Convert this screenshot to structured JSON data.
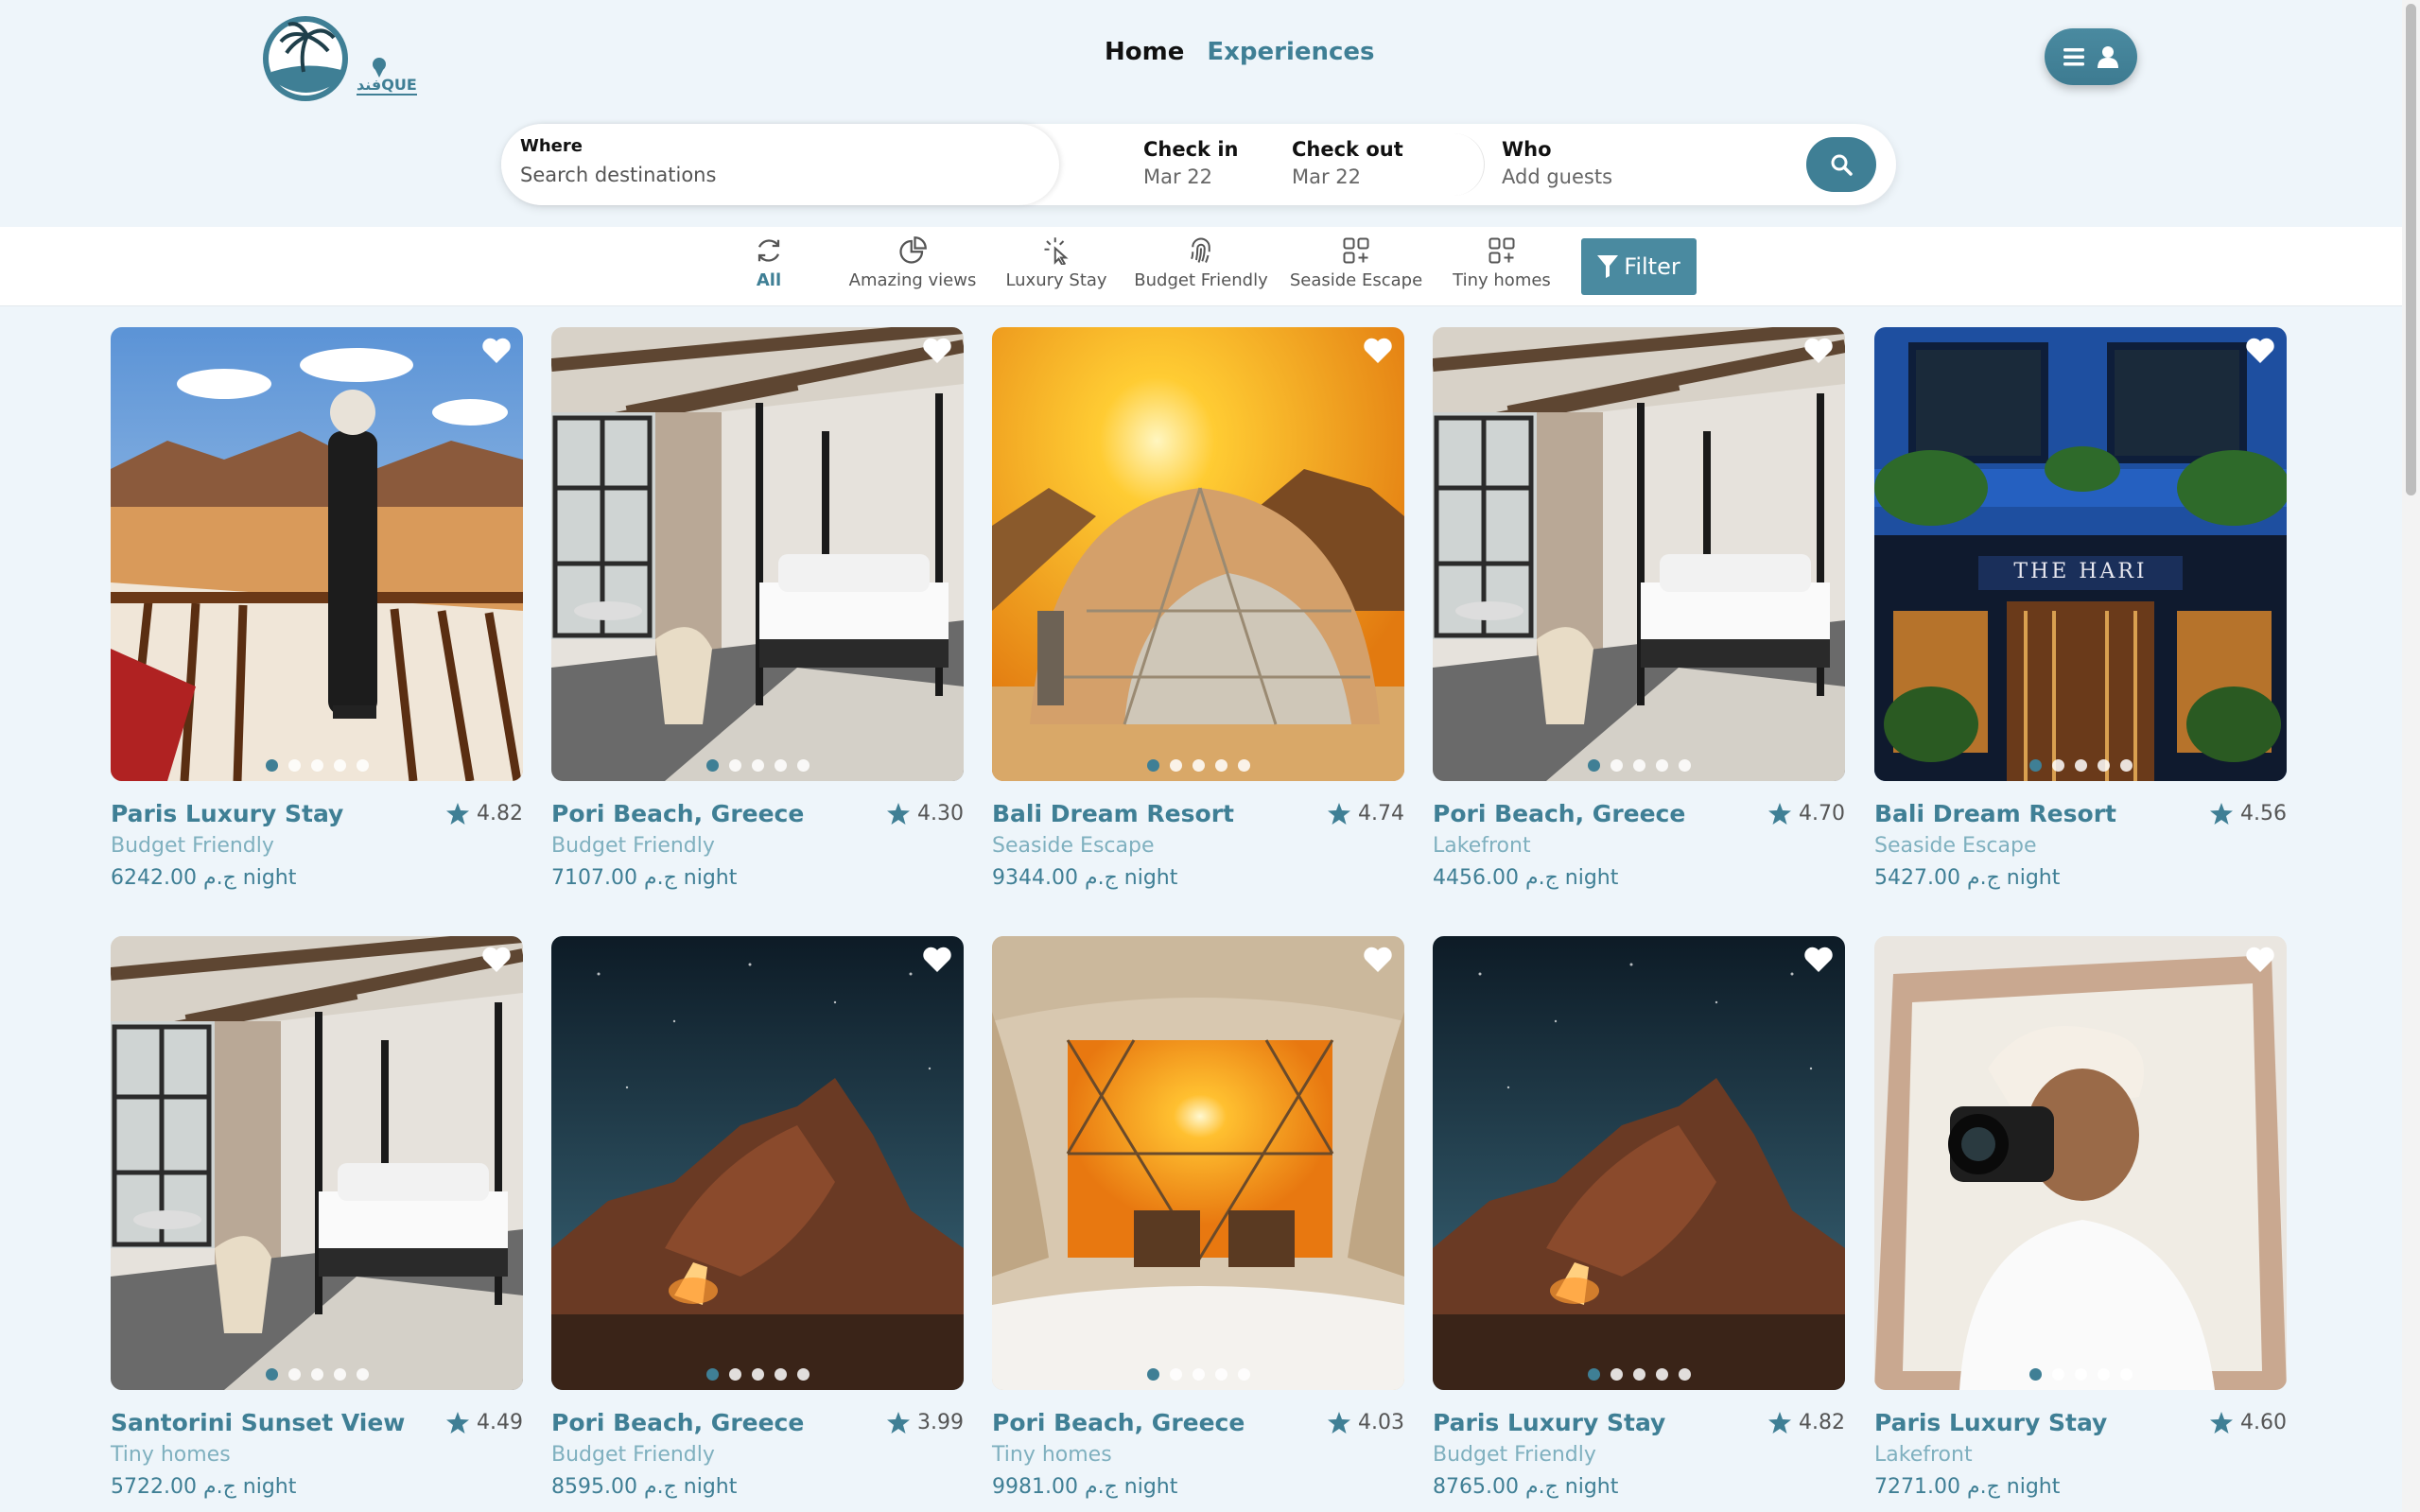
{
  "logo": {
    "text": "فندQUE"
  },
  "nav": {
    "home": "Home",
    "experiences": "Experiences"
  },
  "search": {
    "where_label": "Where",
    "where_placeholder": "Search destinations",
    "checkin_label": "Check in",
    "checkin_value": "Mar 22",
    "checkout_label": "Check out",
    "checkout_value": "Mar 22",
    "who_label": "Who",
    "who_value": "Add guests"
  },
  "categories": [
    {
      "label": "All",
      "icon": "refresh-icon"
    },
    {
      "label": "Amazing views",
      "icon": "pie-chart-icon"
    },
    {
      "label": "Luxury Stay",
      "icon": "pointer-click-icon"
    },
    {
      "label": "Budget Friendly",
      "icon": "fingerprint-icon"
    },
    {
      "label": "Seaside Escape",
      "icon": "grid-plus-icon"
    },
    {
      "label": "Tiny homes",
      "icon": "grid-plus-icon"
    }
  ],
  "filter_label": "Filter",
  "listings": [
    {
      "title": "Paris Luxury Stay",
      "rating": "4.82",
      "category": "Budget Friendly",
      "price": "6242.00 ج.م night",
      "scene": "desert-balcony"
    },
    {
      "title": "Pori Beach, Greece",
      "rating": "4.30",
      "category": "Budget Friendly",
      "price": "7107.00 ج.م night",
      "scene": "bedroom"
    },
    {
      "title": "Bali Dream Resort",
      "rating": "4.74",
      "category": "Seaside Escape",
      "price": "9344.00 ج.م night",
      "scene": "dome-tent"
    },
    {
      "title": "Pori Beach, Greece",
      "rating": "4.70",
      "category": "Lakefront",
      "price": "4456.00 ج.م night",
      "scene": "bedroom"
    },
    {
      "title": "Bali Dream Resort",
      "rating": "4.56",
      "category": "Seaside Escape",
      "price": "5427.00 ج.م night",
      "scene": "hotel-front"
    },
    {
      "title": "Santorini Sunset View",
      "rating": "4.49",
      "category": "Tiny homes",
      "price": "5722.00 ج.م night",
      "scene": "bedroom"
    },
    {
      "title": "Pori Beach, Greece",
      "rating": "3.99",
      "category": "Budget Friendly",
      "price": "8595.00 ج.م night",
      "scene": "night-rock"
    },
    {
      "title": "Pori Beach, Greece",
      "rating": "4.03",
      "category": "Tiny homes",
      "price": "9981.00 ج.م night",
      "scene": "dome-interior"
    },
    {
      "title": "Paris Luxury Stay",
      "rating": "4.82",
      "category": "Budget Friendly",
      "price": "8765.00 ج.م night",
      "scene": "night-rock"
    },
    {
      "title": "Paris Luxury Stay",
      "rating": "4.60",
      "category": "Lakefront",
      "price": "7271.00 ج.م night",
      "scene": "photographer"
    }
  ],
  "hotel_sign": "THE HARI",
  "colors": {
    "accent": "#3f7f95",
    "accent_light": "#7fb0bf",
    "background": "#eef5fa"
  }
}
